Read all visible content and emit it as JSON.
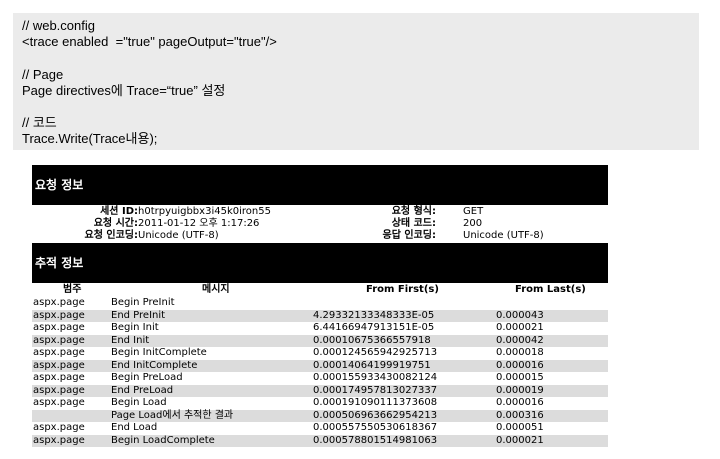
{
  "code": {
    "lines": [
      "// web.config",
      "<trace enabled  =\"true\" pageOutput=\"true\"/>",
      "",
      "// Page",
      "Page directives에 Trace=“true” 설정",
      "",
      "// 코드",
      "Trace.Write(Trace내용);"
    ]
  },
  "request_section": {
    "title": "요청 정보",
    "left": [
      {
        "label": "세션 ID:",
        "value": "h0trpyuigbbx3i45k0iron55"
      },
      {
        "label": "요청 시간:",
        "value": "2011-01-12 오후 1:17:26"
      },
      {
        "label": "요청 인코딩:",
        "value": "Unicode (UTF-8)"
      }
    ],
    "right": [
      {
        "label": "요청 형식:",
        "value": "GET"
      },
      {
        "label": "상태 코드:",
        "value": "200"
      },
      {
        "label": "응답 인코딩:",
        "value": "Unicode (UTF-8)"
      }
    ]
  },
  "trace_section": {
    "title": "추적 정보",
    "columns": [
      "범주",
      "메시지",
      "From First(s)",
      "From Last(s)"
    ],
    "rows": [
      [
        "aspx.page",
        "Begin PreInit",
        "",
        ""
      ],
      [
        "aspx.page",
        "End PreInit",
        "4.29332133348333E-05",
        "0.000043"
      ],
      [
        "aspx.page",
        "Begin Init",
        "6.44166947913151E-05",
        "0.000021"
      ],
      [
        "aspx.page",
        "End Init",
        "0.00010675366557918",
        "0.000042"
      ],
      [
        "aspx.page",
        "Begin InitComplete",
        "0.000124565942925713",
        "0.000018"
      ],
      [
        "aspx.page",
        "End InitComplete",
        "0.00014064199919751",
        "0.000016"
      ],
      [
        "aspx.page",
        "Begin PreLoad",
        "0.000155933430082124",
        "0.000015"
      ],
      [
        "aspx.page",
        "End PreLoad",
        "0.000174957813027337",
        "0.000019"
      ],
      [
        "aspx.page",
        "Begin Load",
        "0.000191090111373608",
        "0.000016"
      ],
      [
        "",
        "Page Load에서 추적한 결과",
        "0.000506963662954213",
        "0.000316"
      ],
      [
        "aspx.page",
        "End Load",
        "0.000557550530618367",
        "0.000051"
      ],
      [
        "aspx.page",
        "Begin LoadComplete",
        "0.000578801514981063",
        "0.000021"
      ]
    ]
  }
}
